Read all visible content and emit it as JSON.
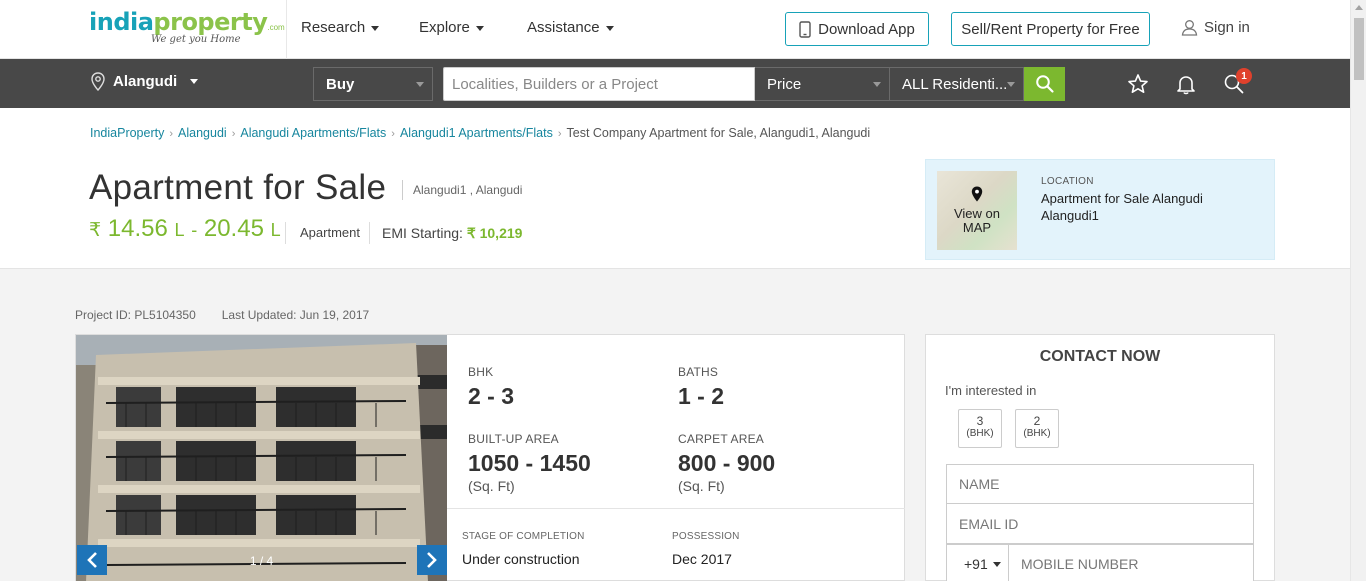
{
  "header": {
    "logo": {
      "part1": "india",
      "part2": "property",
      "suffix": ".com",
      "tagline": "We get you Home"
    },
    "nav": [
      {
        "label": "Research"
      },
      {
        "label": "Explore"
      },
      {
        "label": "Assistance"
      }
    ],
    "download_app_label": "Download App",
    "sell_rent_label": "Sell/Rent Property for Free",
    "signin_label": "Sign in"
  },
  "searchbar": {
    "city": "Alangudi",
    "mode": "Buy",
    "search_placeholder": "Localities, Builders or a Project",
    "price_label": "Price",
    "property_type": "ALL Residenti...",
    "notification_count": "1",
    "icons": [
      "location-pin-icon",
      "search-icon",
      "star-icon",
      "bell-icon",
      "search-history-icon"
    ]
  },
  "breadcrumb": {
    "items": [
      "IndiaProperty",
      "Alangudi",
      "Alangudi Apartments/Flats",
      "Alangudi1 Apartments/Flats"
    ],
    "current": "Test Company Apartment for Sale, Alangudi1, Alangudi"
  },
  "listing": {
    "title": "Apartment for Sale",
    "sublocation": "Alangudi1 , Alangudi",
    "currency_symbol": "₹",
    "price_min": "14.56",
    "price_max": "20.45",
    "price_unit": "L",
    "price_separator": "-",
    "property_type": "Apartment",
    "emi_label": "EMI Starting:",
    "emi_value": "₹ 10,219",
    "project_id": "Project ID: PL5104350",
    "last_updated": "Last Updated: Jun 19, 2017"
  },
  "location_card": {
    "heading": "LOCATION",
    "value": "Apartment for Sale Alangudi Alangudi1",
    "map_label_1": "View on",
    "map_label_2": "MAP"
  },
  "gallery": {
    "counter": "1 / 4"
  },
  "specs": {
    "bhk_label": "BHK",
    "bhk_value": "2 - 3",
    "baths_label": "BATHS",
    "baths_value": "1 - 2",
    "builtup_label": "BUILT-UP AREA",
    "builtup_value": "1050 - 1450",
    "builtup_unit": "(Sq. Ft)",
    "carpet_label": "CARPET AREA",
    "carpet_value": "800 - 900",
    "carpet_unit": "(Sq. Ft)",
    "stage_label": "STAGE OF COMPLETION",
    "stage_value": "Under construction",
    "possession_label": "POSSESSION",
    "possession_value": "Dec 2017"
  },
  "contact": {
    "heading": "CONTACT NOW",
    "interest_label": "I'm interested in",
    "bhk_options": [
      {
        "value": "3",
        "unit": "(BHK)"
      },
      {
        "value": "2",
        "unit": "(BHK)"
      }
    ],
    "name_placeholder": "NAME",
    "email_placeholder": "EMAIL ID",
    "country_code": "+91",
    "mobile_placeholder": "MOBILE NUMBER"
  },
  "colors": {
    "accent_teal": "#17a2b8",
    "accent_green": "#7cb82f",
    "dark_bar": "#484848",
    "arrow_blue": "#1e74b8",
    "badge_red": "#e0412c"
  }
}
